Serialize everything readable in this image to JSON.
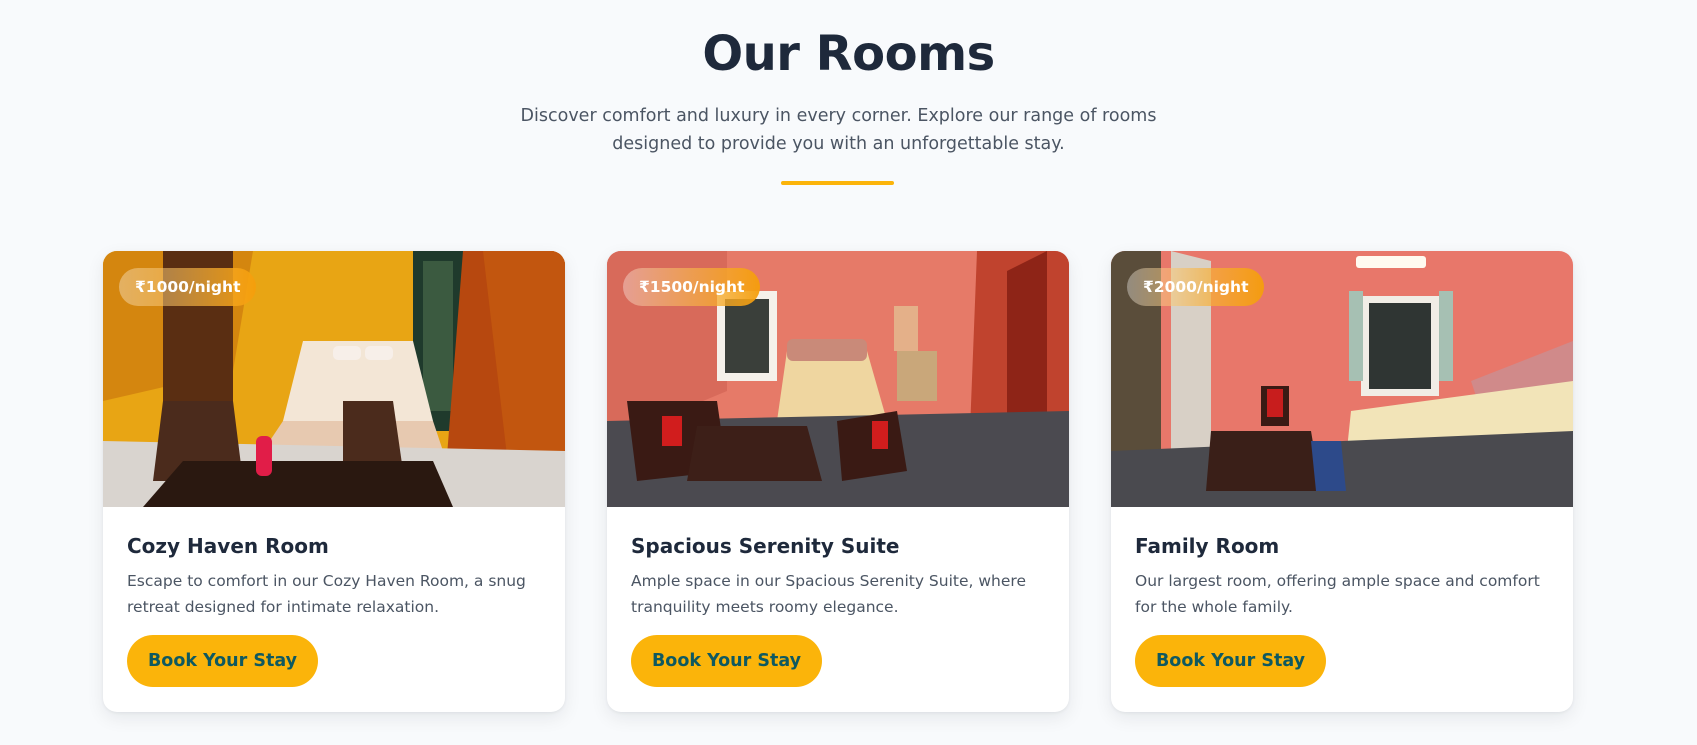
{
  "section": {
    "title": "Our Rooms",
    "subtitle": "Discover comfort and luxury in every corner. Explore our range of rooms designed to provide you with an unforgettable stay."
  },
  "colors": {
    "accent": "#fbb40a",
    "title": "#1e293b",
    "button_text": "#0f5960",
    "background": "#f8fafc"
  },
  "rooms": [
    {
      "price": "₹1000/night",
      "name": "Cozy Haven Room",
      "description": "Escape to comfort in our Cozy Haven Room, a snug retreat designed for intimate relaxation.",
      "button": "Book Your Stay"
    },
    {
      "price": "₹1500/night",
      "name": "Spacious Serenity Suite",
      "description": "Ample space in our Spacious Serenity Suite, where tranquility meets roomy elegance.",
      "button": "Book Your Stay"
    },
    {
      "price": "₹2000/night",
      "name": "Family Room",
      "description": "Our largest room, offering ample space and comfort for the whole family.",
      "button": "Book Your Stay"
    }
  ]
}
